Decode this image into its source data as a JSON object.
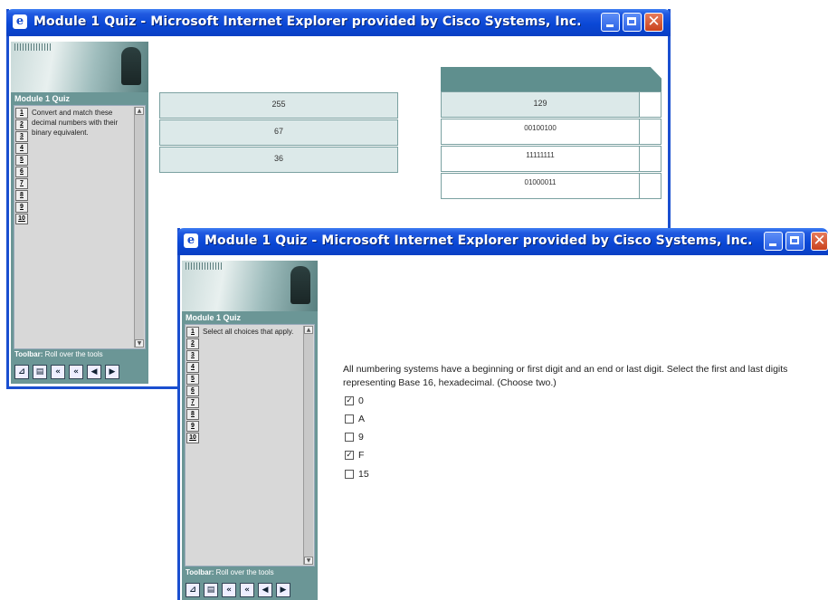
{
  "window_back": {
    "title": "Module 1 Quiz - Microsoft Internet Explorer provided by Cisco Systems, Inc.",
    "side": {
      "title": "Module 1 Quiz",
      "numbers": [
        "1",
        "2",
        "3",
        "4",
        "5",
        "6",
        "7",
        "8",
        "9",
        "10"
      ],
      "instruction": "Convert and match these decimal numbers with their binary equivalent.",
      "toolbar_bold": "Toolbar:",
      "toolbar_text": " Roll over the tools"
    },
    "left_values": [
      "255",
      "67",
      "36"
    ],
    "right_values": [
      "129",
      "00100100",
      "11111111",
      "01000011"
    ]
  },
  "window_front": {
    "title": "Module 1 Quiz - Microsoft Internet Explorer provided by Cisco Systems, Inc.",
    "side": {
      "title": "Module 1 Quiz",
      "numbers": [
        "1",
        "2",
        "3",
        "4",
        "5",
        "6",
        "7",
        "8",
        "9",
        "10"
      ],
      "instruction": "Select all choices that apply.",
      "toolbar_bold": "Toolbar:",
      "toolbar_text": " Roll over the tools"
    },
    "question": "All numbering systems have a beginning or first digit and an end or last digit. Select the first and last digits representing Base 16, hexadecimal. (Choose two.)",
    "choices": [
      {
        "label": "0",
        "checked": true
      },
      {
        "label": "A",
        "checked": false
      },
      {
        "label": "9",
        "checked": false
      },
      {
        "label": "F",
        "checked": true
      },
      {
        "label": "15",
        "checked": false
      }
    ]
  },
  "icons": {
    "ie": "ie-logo-icon",
    "min": "minimize-icon",
    "max": "maximize-icon",
    "close": "close-icon",
    "tools": [
      "pin-icon",
      "notes-icon",
      "first-page-icon",
      "rewind-icon",
      "back-icon",
      "forward-icon"
    ]
  },
  "colors": {
    "titlebar": "#0a48d6",
    "panel": "#6b9696",
    "cell": "#dce9e9"
  }
}
